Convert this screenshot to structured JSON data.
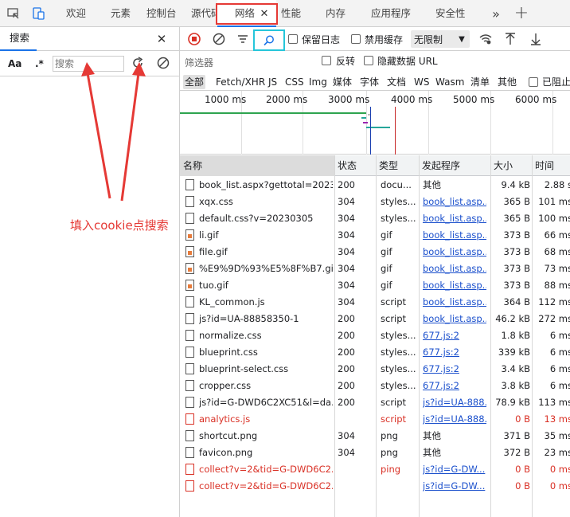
{
  "tabs": [
    {
      "label": "欢迎"
    },
    {
      "label": "元素"
    },
    {
      "label": "控制台"
    },
    {
      "label": "源代码"
    },
    {
      "label": "网络",
      "active": true
    },
    {
      "label": "性能"
    },
    {
      "label": "内存"
    },
    {
      "label": "应用程序"
    },
    {
      "label": "安全性"
    }
  ],
  "search_panel": {
    "tab_label": "搜索",
    "match_case": "Aa",
    "regex": ".*",
    "placeholder": "搜索",
    "annotation": "填入cookie点搜索"
  },
  "toolbar": {
    "preserve_log": "保留日志",
    "disable_cache": "禁用缓存",
    "throttle": "无限制"
  },
  "filter": {
    "label": "筛选器",
    "invert": "反转",
    "hide_data_urls": "隐藏数据 URL",
    "blocked_label": "已阻止",
    "types": [
      "全部",
      "Fetch/XHR",
      "JS",
      "CSS",
      "Img",
      "媒体",
      "字体",
      "文档",
      "WS",
      "Wasm",
      "清单",
      "其他"
    ]
  },
  "timeline": {
    "ticks": [
      "1000 ms",
      "2000 ms",
      "3000 ms",
      "4000 ms",
      "5000 ms",
      "6000 ms"
    ]
  },
  "columns": [
    "名称",
    "状态",
    "类型",
    "发起程序",
    "大小",
    "时间"
  ],
  "rows": [
    {
      "name": "book_list.aspx?gettotal=2023...",
      "status": "200",
      "type": "docu...",
      "initiator": "其他",
      "size": "9.4 kB",
      "time": "2.88 s",
      "link": false,
      "err": false,
      "icon": "doc"
    },
    {
      "name": "xqx.css",
      "status": "304",
      "type": "styles...",
      "initiator": "book_list.asp...",
      "size": "365 B",
      "time": "101 ms",
      "link": true,
      "err": false,
      "icon": "doc"
    },
    {
      "name": "default.css?v=20230305",
      "status": "304",
      "type": "styles...",
      "initiator": "book_list.asp...",
      "size": "365 B",
      "time": "100 ms",
      "link": true,
      "err": false,
      "icon": "doc"
    },
    {
      "name": "li.gif",
      "status": "304",
      "type": "gif",
      "initiator": "book_list.asp...",
      "size": "373 B",
      "time": "66 ms",
      "link": true,
      "err": false,
      "icon": "img"
    },
    {
      "name": "file.gif",
      "status": "304",
      "type": "gif",
      "initiator": "book_list.asp...",
      "size": "373 B",
      "time": "68 ms",
      "link": true,
      "err": false,
      "icon": "img"
    },
    {
      "name": "%E9%9D%93%E5%8F%B7.gif",
      "status": "304",
      "type": "gif",
      "initiator": "book_list.asp...",
      "size": "373 B",
      "time": "73 ms",
      "link": true,
      "err": false,
      "icon": "img"
    },
    {
      "name": "tuo.gif",
      "status": "304",
      "type": "gif",
      "initiator": "book_list.asp...",
      "size": "373 B",
      "time": "88 ms",
      "link": true,
      "err": false,
      "icon": "img"
    },
    {
      "name": "KL_common.js",
      "status": "304",
      "type": "script",
      "initiator": "book_list.asp...",
      "size": "364 B",
      "time": "112 ms",
      "link": true,
      "err": false,
      "icon": "doc"
    },
    {
      "name": "js?id=UA-88858350-1",
      "status": "200",
      "type": "script",
      "initiator": "book_list.asp...",
      "size": "46.2 kB",
      "time": "272 ms",
      "link": true,
      "err": false,
      "icon": "doc"
    },
    {
      "name": "normalize.css",
      "status": "200",
      "type": "styles...",
      "initiator": "677.js:2",
      "size": "1.8 kB",
      "time": "6 ms",
      "link": true,
      "err": false,
      "icon": "doc"
    },
    {
      "name": "blueprint.css",
      "status": "200",
      "type": "styles...",
      "initiator": "677.js:2",
      "size": "339 kB",
      "time": "6 ms",
      "link": true,
      "err": false,
      "icon": "doc"
    },
    {
      "name": "blueprint-select.css",
      "status": "200",
      "type": "styles...",
      "initiator": "677.js:2",
      "size": "3.4 kB",
      "time": "6 ms",
      "link": true,
      "err": false,
      "icon": "doc"
    },
    {
      "name": "cropper.css",
      "status": "200",
      "type": "styles...",
      "initiator": "677.js:2",
      "size": "3.8 kB",
      "time": "6 ms",
      "link": true,
      "err": false,
      "icon": "doc"
    },
    {
      "name": "js?id=G-DWD6C2XC51&l=da...",
      "status": "200",
      "type": "script",
      "initiator": "js?id=UA-888...",
      "size": "78.9 kB",
      "time": "113 ms",
      "link": true,
      "err": false,
      "icon": "doc"
    },
    {
      "name": "analytics.js",
      "status": "",
      "type": "script",
      "initiator": "js?id=UA-888...",
      "size": "0 B",
      "time": "13 ms",
      "link": true,
      "err": true,
      "icon": "doc"
    },
    {
      "name": "shortcut.png",
      "status": "304",
      "type": "png",
      "initiator": "其他",
      "size": "371 B",
      "time": "35 ms",
      "link": false,
      "err": false,
      "icon": "doc"
    },
    {
      "name": "favicon.png",
      "status": "304",
      "type": "png",
      "initiator": "其他",
      "size": "372 B",
      "time": "23 ms",
      "link": false,
      "err": false,
      "icon": "doc"
    },
    {
      "name": "collect?v=2&tid=G-DWD6C2...",
      "status": "",
      "type": "ping",
      "initiator": "js?id=G-DW...",
      "size": "0 B",
      "time": "0 ms",
      "link": true,
      "err": true,
      "icon": "doc"
    },
    {
      "name": "collect?v=2&tid=G-DWD6C2...",
      "status": "",
      "type": "",
      "initiator": "js?id=G-DW...",
      "size": "0 B",
      "time": "0 ms",
      "link": true,
      "err": true,
      "icon": "doc"
    }
  ],
  "colors": {
    "accent": "#1a73e8",
    "error": "#d93025",
    "highlight_red": "#e53935",
    "highlight_cyan": "#26c6da"
  }
}
